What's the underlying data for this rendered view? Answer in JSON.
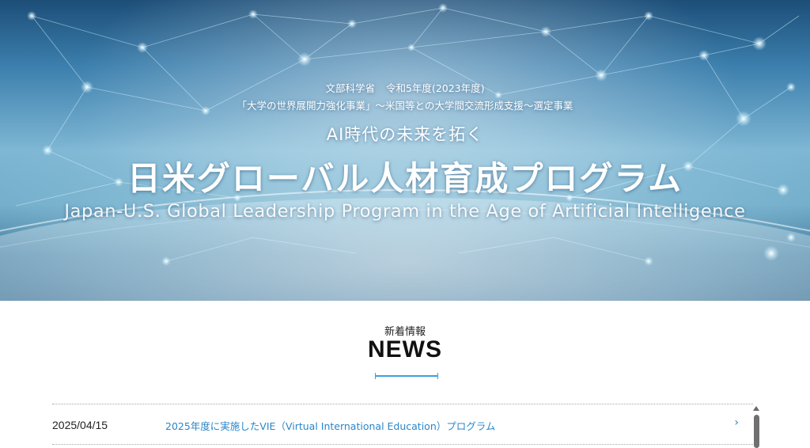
{
  "hero": {
    "ministry_left": "文部科学省",
    "ministry_right": "令和5年度(2023年度)",
    "project": "「大学の世界展開力強化事業」～米国等との大学間交流形成支援～選定事業",
    "tagline": "AI時代の未来を拓く",
    "title_ja": "日米グローバル人材育成プログラム",
    "title_en": "Japan-U.S. Global Leadership Program in the Age of Artificial Intelligence"
  },
  "news": {
    "subtitle": "新着情報",
    "title": "NEWS",
    "items": [
      {
        "date": "2025/04/15",
        "text": "2025年度に実施したVIE（Virtual International Education）プログラム",
        "chevron": "›"
      }
    ]
  },
  "colors": {
    "accent": "#3aa0e0",
    "link": "#2b86c9"
  }
}
